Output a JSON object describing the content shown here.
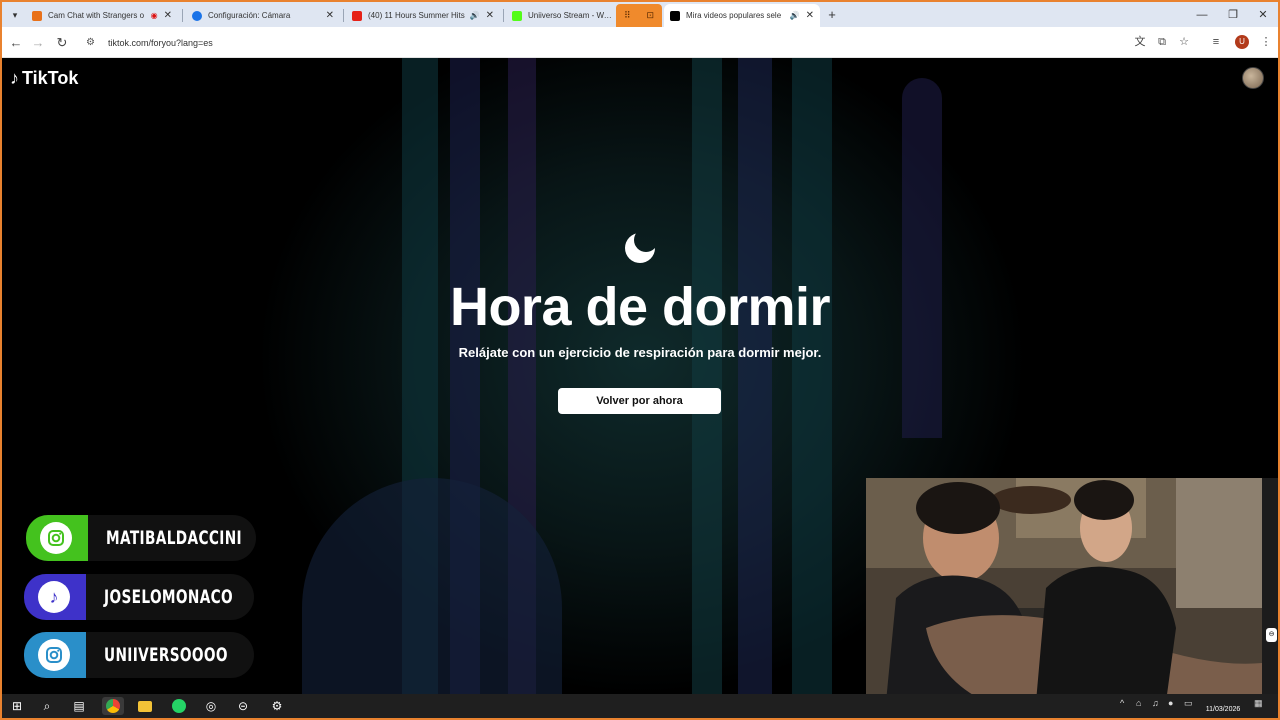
{
  "browser": {
    "tabs": [
      {
        "label": "Cam Chat with Strangers o",
        "icon": "recording-dot-icon",
        "color": "#e8711a"
      },
      {
        "label": "Configuración: Cámara",
        "icon": "gear-icon",
        "color": "#1a73e8"
      },
      {
        "label": "(40) 11 Hours Summer Hits",
        "icon": "youtube-icon",
        "color": "#e62117"
      },
      {
        "label": "Uniiverso Stream - Watch",
        "icon": "kick-icon",
        "color": "#53fc18"
      },
      {
        "label": "Mira videos populares sele",
        "icon": "tiktok-icon",
        "color": "#000000"
      }
    ],
    "url": "tiktok.com/foryou?lang=es"
  },
  "tiktok": {
    "logo_text": "TikTok",
    "heading": "Hora de dormir",
    "subtitle": "Relájate con un ejercicio de respiración para dormir mejor.",
    "button_label": "Volver por ahora"
  },
  "overlay": {
    "socials": [
      {
        "handle": "MATIBALDACCINI",
        "platform": "instagram-icon",
        "tile_color": "#44c21e",
        "circle_color": "#ffffff",
        "icon_color": "#44c21e"
      },
      {
        "handle": "JOSELOMONACO",
        "platform": "tiktok-icon",
        "tile_color": "#3e32c9",
        "circle_color": "#ffffff",
        "icon_color": "#3e32c9"
      },
      {
        "handle": "UNIIVERSOOOO",
        "platform": "instagram-icon",
        "tile_color": "#2a8fc9",
        "circle_color": "#ffffff",
        "icon_color": "#2a8fc9"
      }
    ]
  },
  "taskbar": {
    "date": "11/03/2026"
  },
  "colors": {
    "frame": "#e9822f",
    "tab_group": "#f08a2c",
    "tabstrip": "#dfe6f2"
  }
}
